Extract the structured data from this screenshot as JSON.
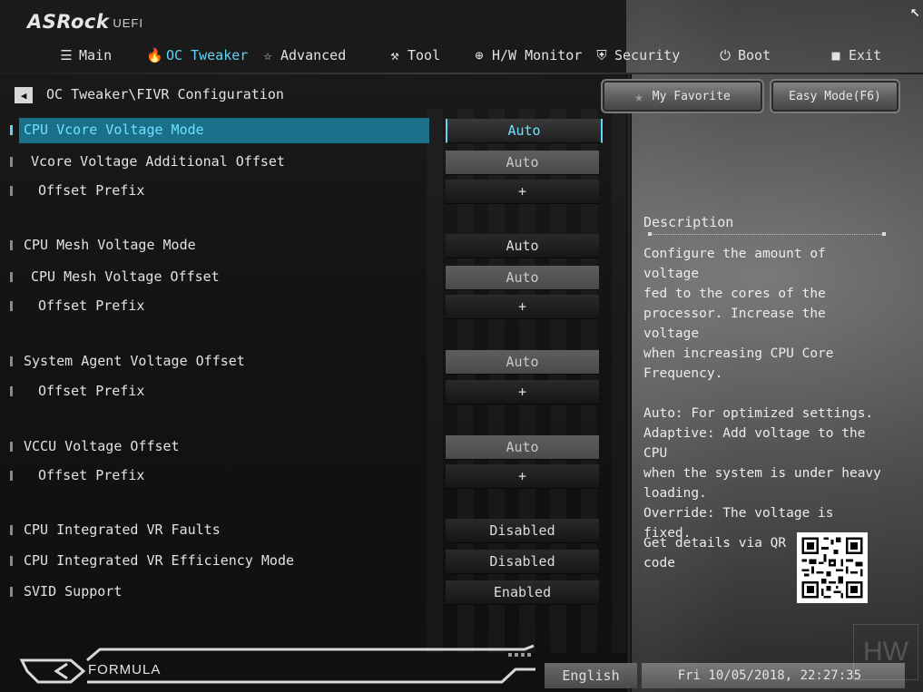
{
  "header": {
    "brand": "ASRock",
    "product": "UEFI"
  },
  "tabs": [
    {
      "label": "Main",
      "icon": "list-icon"
    },
    {
      "label": "OC Tweaker",
      "icon": "flame-icon"
    },
    {
      "label": "Advanced",
      "icon": "star-wand-icon"
    },
    {
      "label": "Tool",
      "icon": "tools-icon"
    },
    {
      "label": "H/W Monitor",
      "icon": "crosshair-icon"
    },
    {
      "label": "Security",
      "icon": "shield-icon"
    },
    {
      "label": "Boot",
      "icon": "power-icon"
    },
    {
      "label": "Exit",
      "icon": "door-icon"
    }
  ],
  "active_tab": "OC Tweaker",
  "breadcrumb": "OC Tweaker\\FIVR Configuration",
  "buttons": {
    "favorite": "My Favorite",
    "easy_mode": "Easy Mode(F6)"
  },
  "settings": [
    {
      "label": "CPU Vcore Voltage Mode",
      "value": "Auto"
    },
    {
      "label": "Vcore Voltage Additional Offset",
      "value": "Auto"
    },
    {
      "label": "Offset Prefix",
      "value": "+"
    },
    {
      "label": "CPU Mesh Voltage Mode",
      "value": "Auto"
    },
    {
      "label": "CPU Mesh Voltage Offset",
      "value": "Auto"
    },
    {
      "label": "Offset Prefix",
      "value": "+"
    },
    {
      "label": "System Agent Voltage Offset",
      "value": "Auto"
    },
    {
      "label": "Offset Prefix",
      "value": "+"
    },
    {
      "label": "VCCU Voltage Offset",
      "value": "Auto"
    },
    {
      "label": "Offset Prefix",
      "value": "+"
    },
    {
      "label": "CPU Integrated VR Faults",
      "value": "Disabled"
    },
    {
      "label": "CPU Integrated VR Efficiency Mode",
      "value": "Disabled"
    },
    {
      "label": "SVID Support",
      "value": "Enabled"
    }
  ],
  "description": {
    "title": "Description",
    "text": "Configure the amount of voltage\nfed to the cores of the\nprocessor. Increase the voltage\nwhen increasing CPU Core\nFrequency.\n\nAuto: For optimized settings.\nAdaptive: Add voltage to the CPU\nwhen the system is under heavy\nloading.\nOverride: The voltage is fixed."
  },
  "qr": {
    "label": "Get details via QR code"
  },
  "footer": {
    "logo_text": "FORMULA",
    "language": "English",
    "datetime": "Fri 10/05/2018, 22:27:35"
  },
  "watermark": "HW",
  "colors": {
    "accent": "#5fd4f4",
    "highlight": "#1a6f89"
  }
}
